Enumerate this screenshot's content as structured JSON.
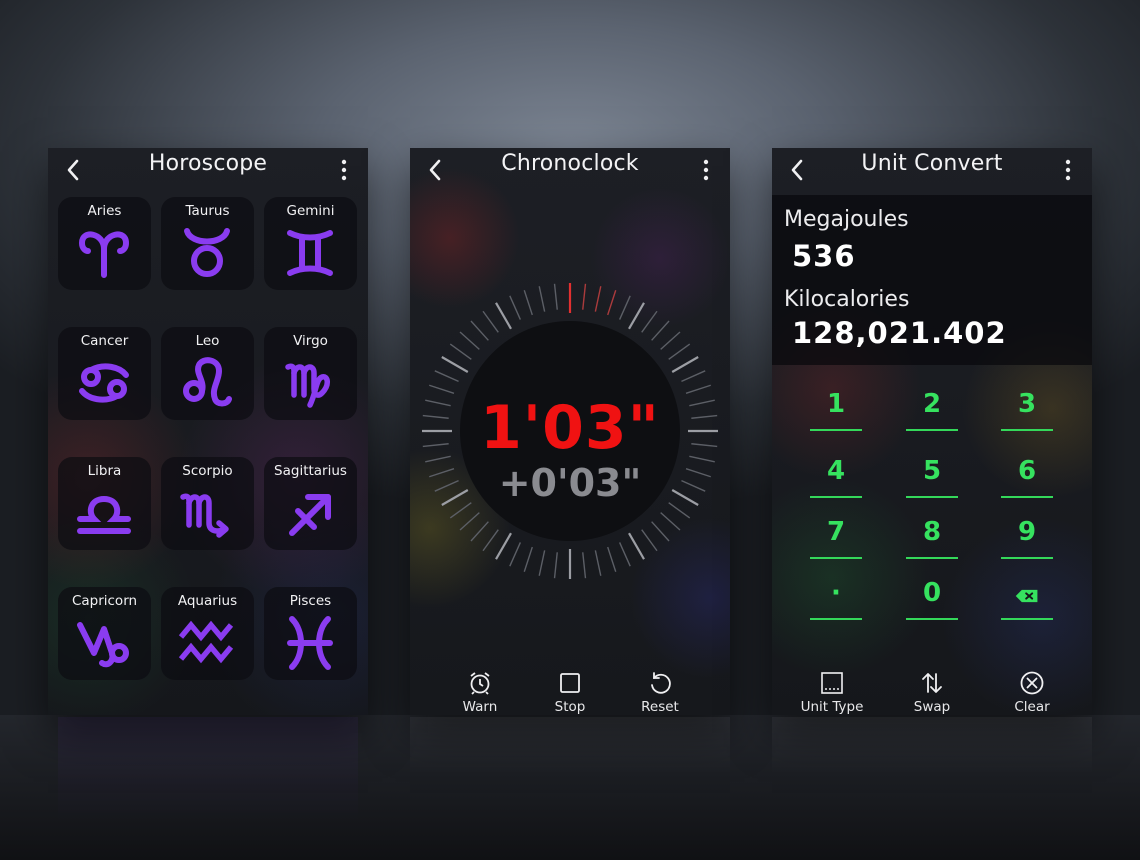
{
  "horoscope": {
    "title": "Horoscope",
    "signs": [
      {
        "name": "Aries",
        "icon": "aries-icon"
      },
      {
        "name": "Taurus",
        "icon": "taurus-icon"
      },
      {
        "name": "Gemini",
        "icon": "gemini-icon"
      },
      {
        "name": "Cancer",
        "icon": "cancer-icon"
      },
      {
        "name": "Leo",
        "icon": "leo-icon"
      },
      {
        "name": "Virgo",
        "icon": "virgo-icon"
      },
      {
        "name": "Libra",
        "icon": "libra-icon"
      },
      {
        "name": "Scorpio",
        "icon": "scorpio-icon"
      },
      {
        "name": "Sagittarius",
        "icon": "sagittarius-icon"
      },
      {
        "name": "Capricorn",
        "icon": "capricorn-icon"
      },
      {
        "name": "Aquarius",
        "icon": "aquarius-icon"
      },
      {
        "name": "Pisces",
        "icon": "pisces-icon"
      }
    ]
  },
  "chrono": {
    "title": "Chronoclock",
    "time": "1'03\"",
    "delta": "+0'03\"",
    "buttons": [
      {
        "label": "Warn",
        "icon": "alarm-clock-icon"
      },
      {
        "label": "Stop",
        "icon": "stop-square-icon"
      },
      {
        "label": "Reset",
        "icon": "reset-icon"
      }
    ]
  },
  "unit": {
    "title": "Unit Convert",
    "from_unit": "Megajoules",
    "from_value": "536",
    "to_unit": "Kilocalories",
    "to_value": "128,021.402",
    "keys": [
      "1",
      "2",
      "3",
      "4",
      "5",
      "6",
      "7",
      "8",
      "9",
      "·",
      "0"
    ],
    "backspace_icon": "backspace-icon",
    "buttons": [
      {
        "label": "Unit Type",
        "icon": "unit-type-icon"
      },
      {
        "label": "Swap",
        "icon": "swap-icon"
      },
      {
        "label": "Clear",
        "icon": "clear-circle-x-icon"
      }
    ]
  },
  "colors": {
    "zodiac_purple": "#8a3cf0",
    "time_red": "#f01212",
    "key_green": "#36e25f"
  }
}
